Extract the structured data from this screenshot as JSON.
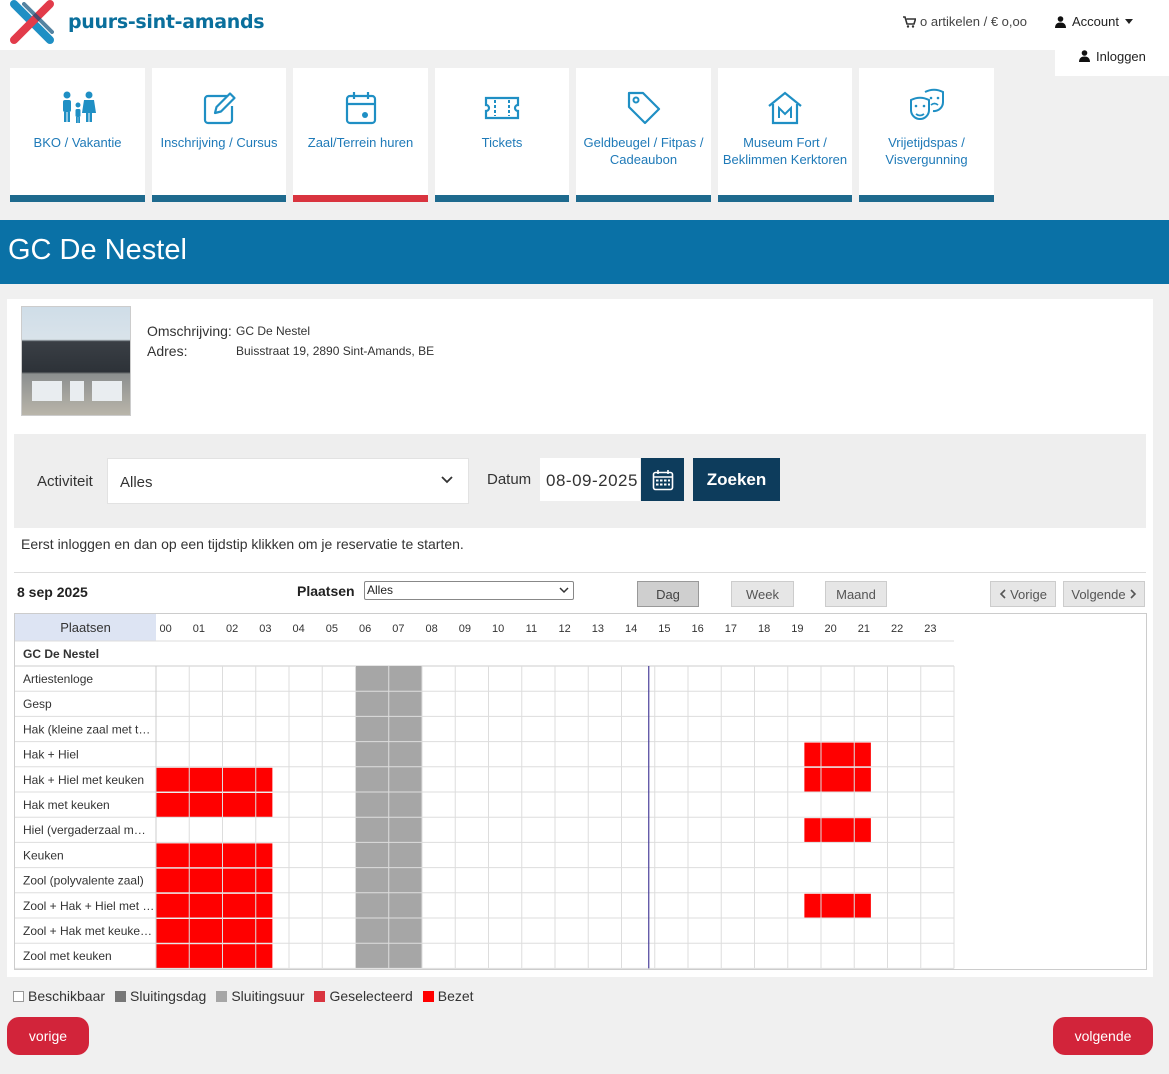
{
  "header": {
    "logo_text": "puurs-sint-amands",
    "cart": "o artikelen / € o,oo",
    "account": "Account",
    "login": "Inloggen"
  },
  "nav": [
    {
      "label": "BKO / Vakantie",
      "icon": "family-icon"
    },
    {
      "label": "Inschrijving / Cursus",
      "icon": "edit-icon"
    },
    {
      "label": "Zaal/Terrein huren",
      "icon": "calendar-icon",
      "active": true
    },
    {
      "label": "Tickets",
      "icon": "ticket-icon"
    },
    {
      "label": "Geldbeugel / Fitpas / Cadeaubon",
      "icon": "tag-icon"
    },
    {
      "label": "Museum Fort / Beklimmen Kerktoren",
      "icon": "museum-icon"
    },
    {
      "label": "Vrijetijdspas / Visvergunning",
      "icon": "theater-masks-icon"
    }
  ],
  "page_title": "GC De Nestel",
  "venue": {
    "desc_label": "Omschrijving:",
    "desc_value": "GC De Nestel",
    "addr_label": "Adres:",
    "addr_value": "Buisstraat 19, 2890 Sint-Amands, BE"
  },
  "filter": {
    "activity_label": "Activiteit",
    "activity_value": "Alles",
    "date_label": "Datum",
    "date_value": "08-09-2025",
    "search_label": "Zoeken"
  },
  "hint": "Eerst inloggen en dan op een tijdstip klikken om je reservatie te starten.",
  "schedule": {
    "date": "8 sep 2025",
    "places_label": "Plaatsen",
    "places_value": "Alles",
    "views": [
      "Dag",
      "Week",
      "Maand"
    ],
    "active_view": "Dag",
    "prev": "Vorige",
    "next": "Volgende",
    "col_header": "Plaatsen",
    "hours": [
      "00",
      "01",
      "02",
      "03",
      "04",
      "05",
      "06",
      "07",
      "08",
      "09",
      "10",
      "11",
      "12",
      "13",
      "14",
      "15",
      "16",
      "17",
      "18",
      "19",
      "20",
      "21",
      "22",
      "23"
    ],
    "group": "GC De Nestel",
    "closed_hours": [
      6,
      7
    ],
    "current_time": 15,
    "rows": [
      {
        "name": "Artiestenloge",
        "busy": []
      },
      {
        "name": "Gesp",
        "busy": []
      },
      {
        "name": "Hak (kleine zaal met t…",
        "busy": []
      },
      {
        "name": "Hak + Hiel",
        "busy": [
          [
            19.5,
            21.5
          ]
        ]
      },
      {
        "name": "Hak + Hiel met keuken",
        "busy": [
          [
            0,
            3.5
          ],
          [
            19.5,
            21.5
          ]
        ]
      },
      {
        "name": "Hak met keuken",
        "busy": [
          [
            0,
            3.5
          ]
        ]
      },
      {
        "name": "Hiel (vergaderzaal m…",
        "busy": [
          [
            19.5,
            21.5
          ]
        ]
      },
      {
        "name": "Keuken",
        "busy": [
          [
            0,
            3.5
          ]
        ]
      },
      {
        "name": "Zool (polyvalente zaal)",
        "busy": [
          [
            0,
            3.5
          ]
        ]
      },
      {
        "name": "Zool + Hak + Hiel met …",
        "busy": [
          [
            0,
            3.5
          ],
          [
            19.5,
            21.5
          ]
        ]
      },
      {
        "name": "Zool + Hak met keuke…",
        "busy": [
          [
            0,
            3.5
          ]
        ]
      },
      {
        "name": "Zool met keuken",
        "busy": [
          [
            0,
            3.5
          ]
        ]
      }
    ]
  },
  "legend": [
    {
      "label": "Beschikbaar",
      "color": "#ffffff"
    },
    {
      "label": "Sluitingsdag",
      "color": "#777777"
    },
    {
      "label": "Sluitingsuur",
      "color": "#a6a6a6"
    },
    {
      "label": "Geselecteerd",
      "color": "#d9343f"
    },
    {
      "label": "Bezet",
      "color": "#ff0000"
    }
  ],
  "footer": {
    "prev": "vorige",
    "next": "volgende"
  },
  "colors": {
    "brand": "#0a71a6",
    "accent": "#d2243a",
    "busy": "#ff0000",
    "closed": "#a6a6a6"
  }
}
